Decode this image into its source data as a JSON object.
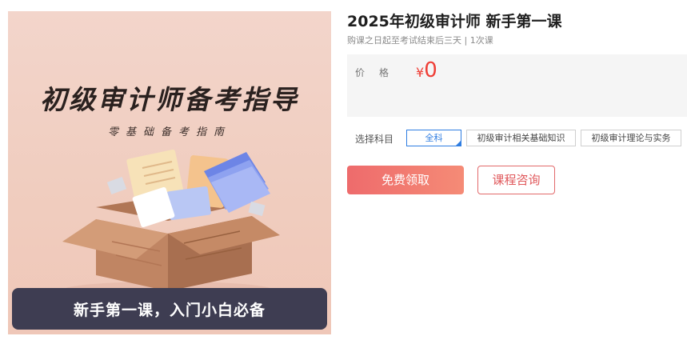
{
  "cover": {
    "title": "初级审计师备考指导",
    "subtitle": "零基础备考指南",
    "bottom_bar": "新手第一课，入门小白必备"
  },
  "course": {
    "title": "2025年初级审计师 新手第一课",
    "meta": "购课之日起至考试结束后三天 | 1次课"
  },
  "price": {
    "label": "价格",
    "currency": "¥",
    "value": "0"
  },
  "subjects": {
    "label": "选择科目",
    "options": [
      "全科",
      "初级审计相关基础知识",
      "初级审计理论与实务"
    ],
    "selected": "全科"
  },
  "actions": {
    "free_label": "免费领取",
    "consult_label": "课程咨询"
  },
  "colors": {
    "accent_red": "#ef3e36",
    "button_gradient_start": "#ee6b6c",
    "button_gradient_end": "#f58b76",
    "selected_blue": "#2f7de1",
    "cover_bar": "#3e3d52"
  }
}
